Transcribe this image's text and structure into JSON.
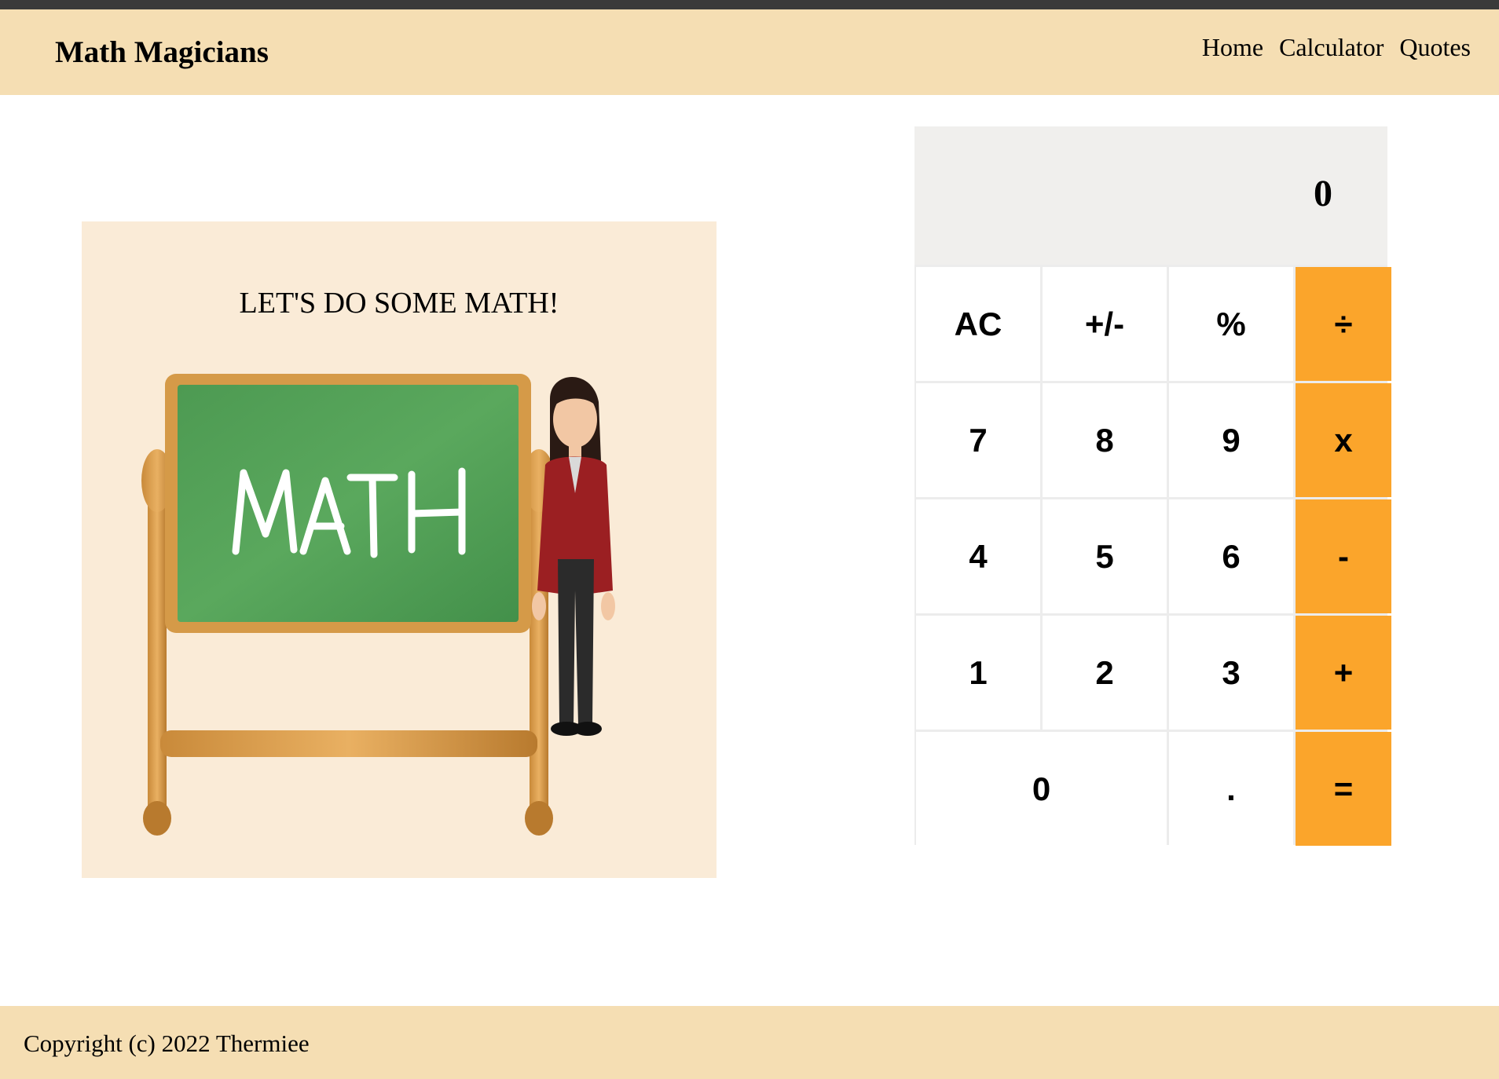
{
  "app": {
    "brand": "Math Magicians"
  },
  "nav": {
    "links": [
      {
        "label": "Home"
      },
      {
        "label": "Calculator"
      },
      {
        "label": "Quotes"
      }
    ]
  },
  "hero": {
    "title": "LET'S DO SOME MATH!",
    "chalkboard_text": "MATH"
  },
  "calculator": {
    "display": "0",
    "keys": [
      {
        "label": "AC",
        "type": "function"
      },
      {
        "label": "+/-",
        "type": "function"
      },
      {
        "label": "%",
        "type": "function"
      },
      {
        "label": "÷",
        "type": "operator"
      },
      {
        "label": "7",
        "type": "digit"
      },
      {
        "label": "8",
        "type": "digit"
      },
      {
        "label": "9",
        "type": "digit"
      },
      {
        "label": "x",
        "type": "operator"
      },
      {
        "label": "4",
        "type": "digit"
      },
      {
        "label": "5",
        "type": "digit"
      },
      {
        "label": "6",
        "type": "digit"
      },
      {
        "label": "-",
        "type": "operator"
      },
      {
        "label": "1",
        "type": "digit"
      },
      {
        "label": "2",
        "type": "digit"
      },
      {
        "label": "3",
        "type": "digit"
      },
      {
        "label": "+",
        "type": "operator"
      },
      {
        "label": "0",
        "type": "digit"
      },
      {
        "label": ".",
        "type": "digit"
      },
      {
        "label": "=",
        "type": "operator"
      }
    ],
    "colors": {
      "operator": "#fba52b",
      "key": "#ffffff",
      "display_bg": "#f0efed"
    }
  },
  "footer": {
    "text": "Copyright (c) 2022 Thermiee"
  },
  "theme": {
    "navbar_bg": "#f5deb3",
    "card_bg": "#faebd7"
  }
}
